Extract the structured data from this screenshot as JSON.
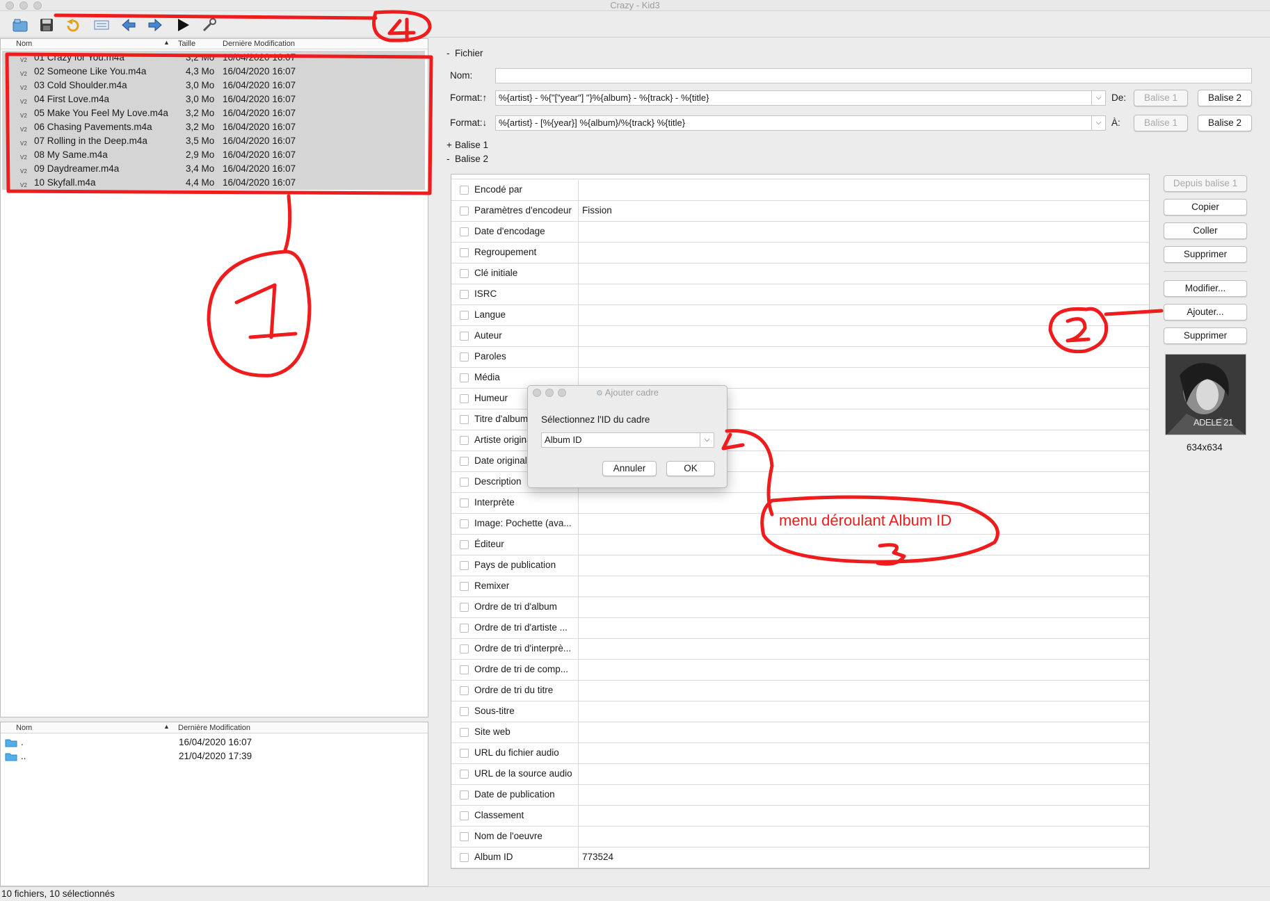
{
  "window": {
    "title": "Crazy - Kid3"
  },
  "annotations": {
    "one": "1",
    "two": "2",
    "three": "3",
    "four": "4",
    "note": "menu déroulant Album ID",
    "color": "#ee1c1c"
  },
  "file_list": {
    "headers": {
      "name": "Nom",
      "size": "Taille",
      "modified": "Dernière Modification"
    },
    "tag_marker": "V2",
    "rows": [
      {
        "name": "01 Crazy for You.m4a",
        "size": "3,2 Mo",
        "date": "16/04/2020 16:07"
      },
      {
        "name": "02 Someone Like You.m4a",
        "size": "4,3 Mo",
        "date": "16/04/2020 16:07"
      },
      {
        "name": "03 Cold Shoulder.m4a",
        "size": "3,0 Mo",
        "date": "16/04/2020 16:07"
      },
      {
        "name": "04 First Love.m4a",
        "size": "3,0 Mo",
        "date": "16/04/2020 16:07"
      },
      {
        "name": "05 Make You Feel My Love.m4a",
        "size": "3,2 Mo",
        "date": "16/04/2020 16:07"
      },
      {
        "name": "06 Chasing Pavements.m4a",
        "size": "3,2 Mo",
        "date": "16/04/2020 16:07"
      },
      {
        "name": "07 Rolling in the Deep.m4a",
        "size": "3,5 Mo",
        "date": "16/04/2020 16:07"
      },
      {
        "name": "08 My Same.m4a",
        "size": "2,9 Mo",
        "date": "16/04/2020 16:07"
      },
      {
        "name": "09 Daydreamer.m4a",
        "size": "3,4 Mo",
        "date": "16/04/2020 16:07"
      },
      {
        "name": "10 Skyfall.m4a",
        "size": "4,4 Mo",
        "date": "16/04/2020 16:07"
      }
    ]
  },
  "dir_list": {
    "headers": {
      "name": "Nom",
      "modified": "Dernière Modification"
    },
    "rows": [
      {
        "name": ".",
        "date": "16/04/2020 16:07"
      },
      {
        "name": "..",
        "date": "21/04/2020 17:39"
      }
    ]
  },
  "file_section": {
    "title": "Fichier",
    "name_label": "Nom:",
    "name_value": "",
    "format_up_label": "Format:↑",
    "format_up_value": "%{artist} - %{\"[\"year\"] \"}%{album} - %{track} - %{title}",
    "from_label": "De:",
    "format_down_label": "Format:↓",
    "format_down_value": "%{artist} - [%{year}] %{album}/%{track} %{title}",
    "to_label": "À:",
    "tag1_btn": "Balise 1",
    "tag2_btn": "Balise 2"
  },
  "sections": {
    "tag1": "Balise 1",
    "tag2": "Balise 2",
    "expand": "+",
    "collapse": "-"
  },
  "tags": [
    {
      "name": "Encodé par",
      "value": ""
    },
    {
      "name": "Paramètres d'encodeur",
      "value": "Fission"
    },
    {
      "name": "Date d'encodage",
      "value": ""
    },
    {
      "name": "Regroupement",
      "value": ""
    },
    {
      "name": "Clé initiale",
      "value": ""
    },
    {
      "name": "ISRC",
      "value": ""
    },
    {
      "name": "Langue",
      "value": ""
    },
    {
      "name": "Auteur",
      "value": ""
    },
    {
      "name": "Paroles",
      "value": ""
    },
    {
      "name": "Média",
      "value": ""
    },
    {
      "name": "Humeur",
      "value": ""
    },
    {
      "name": "Titre d'album",
      "value": ""
    },
    {
      "name": "Artiste original",
      "value": ""
    },
    {
      "name": "Date original",
      "value": ""
    },
    {
      "name": "Description",
      "value": ""
    },
    {
      "name": "Interprète",
      "value": ""
    },
    {
      "name": "Image: Pochette (ava...",
      "value": ""
    },
    {
      "name": "Éditeur",
      "value": ""
    },
    {
      "name": "Pays de publication",
      "value": ""
    },
    {
      "name": "Remixer",
      "value": ""
    },
    {
      "name": "Ordre de tri d'album",
      "value": ""
    },
    {
      "name": "Ordre de tri d'artiste ...",
      "value": ""
    },
    {
      "name": "Ordre de tri d'interprè...",
      "value": ""
    },
    {
      "name": "Ordre de tri de comp...",
      "value": ""
    },
    {
      "name": "Ordre de tri du titre",
      "value": ""
    },
    {
      "name": "Sous-titre",
      "value": ""
    },
    {
      "name": "Site web",
      "value": ""
    },
    {
      "name": "URL du fichier audio",
      "value": ""
    },
    {
      "name": "URL de la source audio",
      "value": ""
    },
    {
      "name": "Date de publication",
      "value": ""
    },
    {
      "name": "Classement",
      "value": ""
    },
    {
      "name": "Nom de l'oeuvre",
      "value": ""
    },
    {
      "name": "Album ID",
      "value": "773524"
    }
  ],
  "side_buttons": {
    "from_tag1": "Depuis balise 1",
    "copy": "Copier",
    "paste": "Coller",
    "remove": "Supprimer",
    "edit": "Modifier...",
    "add": "Ajouter...",
    "delete": "Supprimer"
  },
  "cover": {
    "text": "ADELE 21",
    "size": "634x634"
  },
  "dialog": {
    "title": "Ajouter cadre",
    "prompt": "Sélectionnez l'ID du cadre",
    "selected": "Album ID",
    "cancel": "Annuler",
    "ok": "OK"
  },
  "status": "10 fichiers, 10 sélectionnés"
}
